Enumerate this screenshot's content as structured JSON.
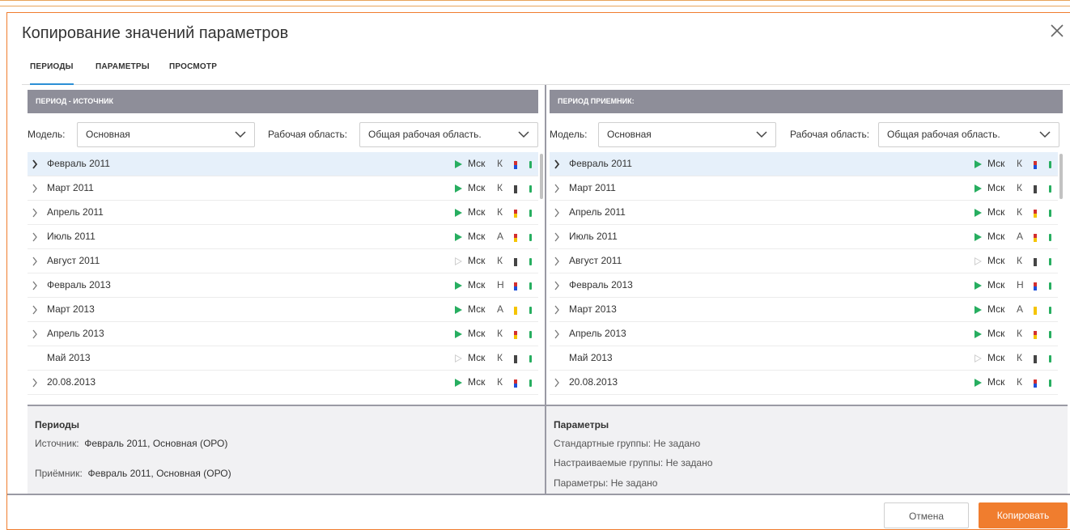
{
  "dialog": {
    "title": "Копирование значений параметров",
    "tabs": [
      "ПЕРИОДЫ",
      "ПАРАМЕТРЫ",
      "ПРОСМОТР"
    ],
    "active_tab": "ПЕРИОДЫ",
    "close_icon": "close-icon"
  },
  "colors": {
    "accent": "#f07d2e",
    "tab_active": "#2b8fd6",
    "header_bg": "#8e8e99",
    "selected_row": "#e6f0fa",
    "play_green": "#27ae60",
    "play_light": "#cfcfcf"
  },
  "source": {
    "header": "ПЕРИОД - ИСТОЧНИК",
    "model_label": "Модель:",
    "model_value": "Основная",
    "workspace_label": "Рабочая область:",
    "workspace_value": "Общая рабочая область."
  },
  "target": {
    "header": "ПЕРИОД ПРИЕМНИК:",
    "model_label": "Модель:",
    "model_value": "Основная",
    "workspace_label": "Рабочая область:",
    "workspace_value": "Общая рабочая область."
  },
  "periods": [
    {
      "name": "Февраль 2011",
      "expandable": true,
      "selected": true,
      "active": true,
      "msk": "Мск",
      "letter": "К",
      "colors": [
        "#d32f2f",
        "#1e4fd8"
      ]
    },
    {
      "name": "Март 2011",
      "expandable": true,
      "selected": false,
      "active": true,
      "msk": "Мск",
      "letter": "К",
      "colors": [
        "#444444",
        "#444444"
      ]
    },
    {
      "name": "Апрель 2011",
      "expandable": true,
      "selected": false,
      "active": true,
      "msk": "Мск",
      "letter": "К",
      "colors": [
        "#d32f2f",
        "#f5c400"
      ]
    },
    {
      "name": "Июль 2011",
      "expandable": true,
      "selected": false,
      "active": true,
      "msk": "Мск",
      "letter": "А",
      "colors": [
        "#d32f2f",
        "#f5c400"
      ]
    },
    {
      "name": "Август 2011",
      "expandable": true,
      "selected": false,
      "active": false,
      "msk": "Мск",
      "letter": "К",
      "colors": [
        "#444444",
        "#444444"
      ]
    },
    {
      "name": "Февраль 2013",
      "expandable": true,
      "selected": false,
      "active": true,
      "msk": "Мск",
      "letter": "Н",
      "colors": [
        "#d32f2f",
        "#1e4fd8"
      ]
    },
    {
      "name": "Март 2013",
      "expandable": true,
      "selected": false,
      "active": true,
      "msk": "Мск",
      "letter": "А",
      "colors": [
        "#f5c400",
        "#f5c400"
      ]
    },
    {
      "name": "Апрель 2013",
      "expandable": true,
      "selected": false,
      "active": true,
      "msk": "Мск",
      "letter": "К",
      "colors": [
        "#d32f2f",
        "#f5c400"
      ]
    },
    {
      "name": "Май 2013",
      "expandable": false,
      "selected": false,
      "active": false,
      "msk": "Мск",
      "letter": "К",
      "colors": [
        "#444444",
        "#444444"
      ]
    },
    {
      "name": "20.08.2013",
      "expandable": true,
      "selected": false,
      "active": true,
      "msk": "Мск",
      "letter": "К",
      "colors": [
        "#d32f2f",
        "#1e4fd8"
      ]
    }
  ],
  "summary_left": {
    "heading": "Периоды",
    "source_label": "Источник:",
    "source_value": "Февраль 2011, Основная (ОРО)",
    "target_label": "Приёмник:",
    "target_value": "Февраль 2011, Основная (ОРО)"
  },
  "summary_right": {
    "heading": "Параметры",
    "line1": "Стандартные группы: Не задано",
    "line2": "Настраиваемые группы: Не задано",
    "line3": "Параметры: Не задано"
  },
  "buttons": {
    "cancel": "Отмена",
    "copy": "Копировать"
  }
}
